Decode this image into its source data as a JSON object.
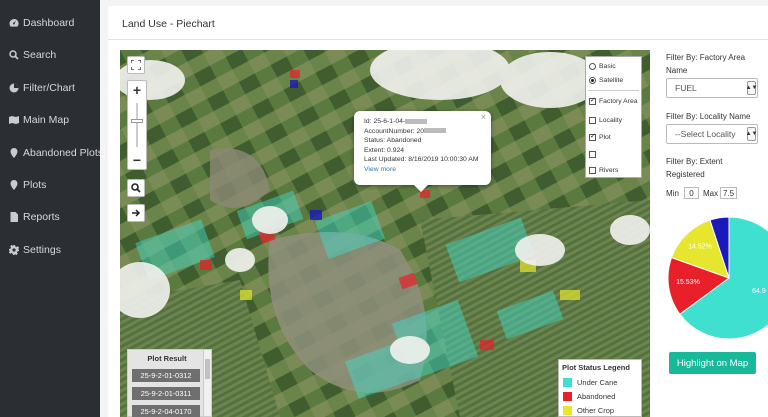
{
  "sidebar": {
    "items": [
      {
        "label": "Dashboard",
        "icon": "dashboard-icon"
      },
      {
        "label": "Search",
        "icon": "search-icon"
      },
      {
        "label": "Filter/Chart",
        "icon": "filter-icon"
      },
      {
        "label": "Main Map",
        "icon": "map-icon"
      },
      {
        "label": "Abandoned Plots",
        "icon": "map-marker-icon"
      },
      {
        "label": "Plots",
        "icon": "map-marker-icon"
      },
      {
        "label": "Reports",
        "icon": "document-icon"
      },
      {
        "label": "Settings",
        "icon": "gear-icon"
      }
    ]
  },
  "page": {
    "title": "Land Use - Piechart"
  },
  "map": {
    "popup": {
      "id": "Id: 25-6-1-04-",
      "account": "AccountNumber: 20",
      "status": "Status: Abandoned",
      "extent": "Extent: 0.924",
      "updated": "Last Updated: 8/16/2019 10:00:30 AM",
      "link": "View more",
      "close": "×"
    },
    "layers": {
      "base": [
        {
          "label": "Basic",
          "selected": false
        },
        {
          "label": "Satellite",
          "selected": true
        }
      ],
      "overlays": [
        {
          "label": "Factory Area",
          "checked": true
        },
        {
          "label": "Locality",
          "checked": false
        },
        {
          "label": "Plot",
          "checked": true
        },
        {
          "label": "",
          "checked": false
        },
        {
          "label": "Rivers",
          "checked": false
        }
      ]
    },
    "plot_result": {
      "title": "Plot Result",
      "items": [
        "25-9-2-01-0312",
        "25-9-2-01-0311",
        "25-9-2-04-0170"
      ]
    },
    "legend": {
      "title": "Plot Status Legend",
      "items": [
        {
          "label": "Under Cane",
          "color": "#40e0d0"
        },
        {
          "label": "Abandoned",
          "color": "#e8202a"
        },
        {
          "label": "Other Crop",
          "color": "#e6e62e"
        }
      ]
    }
  },
  "filters": {
    "factory_area_label": "Filter By: Factory Area Name",
    "factory_area_value": "FUEL",
    "locality_label": "Filter By: Locality Name",
    "locality_value": "--Select Locality",
    "extent_label": "Filter By: Extent Registered",
    "min_label": "Min",
    "min_value": "0",
    "max_label": "Max",
    "max_value": "7.5"
  },
  "chart_data": {
    "type": "pie",
    "slices": [
      {
        "label": "64.9",
        "value": 64.9,
        "color": "#40e0d0"
      },
      {
        "label": "15.53%",
        "value": 15.53,
        "color": "#e8202a"
      },
      {
        "label": "14.52%",
        "value": 14.52,
        "color": "#e6e62e"
      },
      {
        "label": "",
        "value": 5.05,
        "color": "#1a1ab8"
      }
    ]
  },
  "action": {
    "highlight_label": "Highlight on Map"
  },
  "colors": {
    "sidebar_bg": "#2b2f33",
    "accent": "#18b99a"
  }
}
